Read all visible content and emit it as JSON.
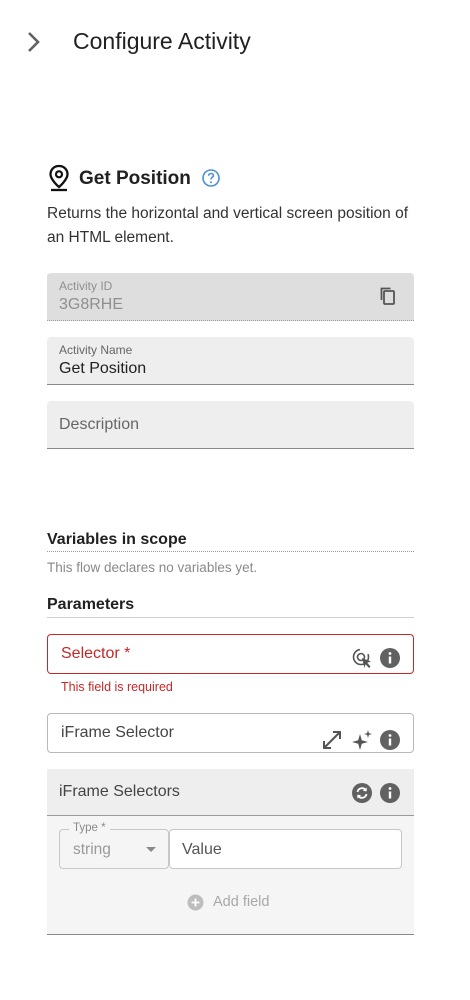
{
  "header": {
    "title": "Configure Activity",
    "collapse_icon": "chevron-right-icon"
  },
  "activity": {
    "icon": "location-pin-icon",
    "name": "Get Position",
    "help_icon": "help-circle-icon",
    "description": "Returns the horizontal and vertical screen position of an HTML element."
  },
  "fields": {
    "activity_id": {
      "label": "Activity ID",
      "value": "3G8RHE",
      "icon": "copy-icon"
    },
    "activity_name": {
      "label": "Activity Name",
      "value": "Get Position"
    },
    "description": {
      "placeholder": "Description"
    }
  },
  "variables": {
    "heading": "Variables in scope",
    "empty_text": "This flow declares no variables yet."
  },
  "parameters": {
    "heading": "Parameters",
    "selector": {
      "label": "Selector *",
      "error": "This field is required",
      "icons": [
        "target-picker-icon",
        "info-icon"
      ]
    },
    "iframe_selector": {
      "label": "iFrame Selector",
      "icons": [
        "expand-icon",
        "sparkle-icon",
        "info-icon"
      ]
    },
    "iframe_selectors": {
      "label": "iFrame Selectors",
      "icons": [
        "refresh-icon",
        "info-icon"
      ],
      "type_label": "Type *",
      "type_value": "string",
      "value_placeholder": "Value",
      "add_label": "Add field"
    }
  },
  "colors": {
    "error": "#c62828",
    "help": "#4a8fd8",
    "icon": "#555555"
  }
}
